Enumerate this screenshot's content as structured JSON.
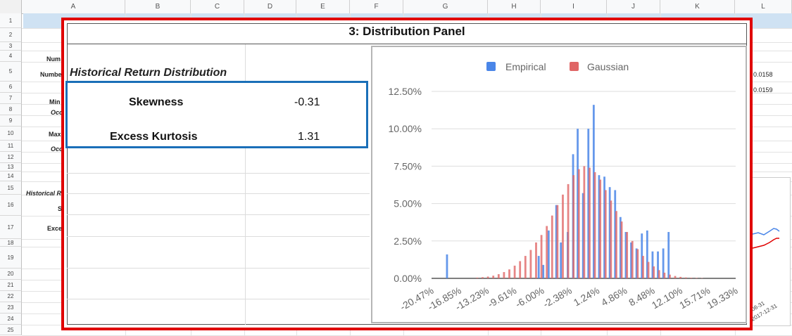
{
  "sheet": {
    "columns": [
      "A",
      "B",
      "C",
      "D",
      "E",
      "F",
      "G",
      "H",
      "I",
      "J",
      "K",
      "L"
    ],
    "rows": [
      "1",
      "2",
      "3",
      "4",
      "5",
      "6",
      "7",
      "8",
      "9",
      "10",
      "11",
      "12",
      "13",
      "14",
      "15",
      "16",
      "17",
      "18",
      "19",
      "20",
      "21",
      "22",
      "23",
      "24",
      "25"
    ],
    "background_cells": {
      "r4": "Num",
      "r5": "Numbe",
      "r7": "Min",
      "r8": "Occ",
      "r10": "Max",
      "r11": "Occ",
      "r15": "Historical R",
      "r16": "S",
      "r17": "Exce",
      "l5": "0.0158",
      "l6": "0.0159",
      "date1": "08-31",
      "date2": "2017-12-31"
    }
  },
  "panel": {
    "title": "3: Distribution Panel",
    "heading": "Historical Return Distribution",
    "stats": [
      {
        "label": "Skewness",
        "value": "-0.31"
      },
      {
        "label": "Excess Kurtosis",
        "value": "1.31"
      }
    ]
  },
  "colors": {
    "highlight_border": "#e00000",
    "stats_border": "#1a6fb8",
    "empirical": "#4a86e8",
    "gaussian": "#e06666",
    "header_band": "#cfe2f3"
  },
  "chart_data": {
    "type": "bar",
    "legend": [
      "Empirical",
      "Gaussian"
    ],
    "legend_position": "top",
    "y_ticks": [
      "0.00%",
      "2.50%",
      "5.00%",
      "7.50%",
      "10.00%",
      "12.50%"
    ],
    "ylim": [
      0,
      12.5
    ],
    "x_ticks": [
      "-20.47%",
      "-16.85%",
      "-13.23%",
      "-9.61%",
      "-6.00%",
      "-2.38%",
      "1.24%",
      "4.86%",
      "8.48%",
      "12.10%",
      "15.71%",
      "19.33%"
    ],
    "xlim": [
      -20.47,
      19.33
    ],
    "series": [
      {
        "name": "Empirical",
        "x": [
          -18.3,
          -6.3,
          -5.7,
          -5.0,
          -4.0,
          -3.4,
          -2.5,
          -1.8,
          -1.2,
          -0.5,
          0.2,
          0.9,
          1.6,
          2.3,
          3.0,
          3.7,
          4.4,
          5.1,
          5.8,
          6.5,
          7.2,
          7.9,
          8.6,
          9.3,
          10.0,
          10.7
        ],
        "values": [
          1.6,
          1.5,
          0.9,
          3.2,
          4.9,
          2.4,
          3.1,
          8.3,
          10.0,
          5.7,
          10.0,
          11.6,
          6.9,
          6.8,
          6.1,
          5.9,
          4.1,
          3.1,
          2.4,
          2.0,
          3.0,
          3.2,
          1.8,
          1.8,
          2.0,
          3.1
        ]
      },
      {
        "name": "Gaussian",
        "x": [
          -14.6,
          -13.9,
          -13.2,
          -12.5,
          -11.8,
          -11.1,
          -10.4,
          -9.7,
          -9.0,
          -8.3,
          -7.6,
          -6.9,
          -6.2,
          -5.5,
          -4.8,
          -4.1,
          -3.4,
          -2.7,
          -2.0,
          -1.3,
          -0.6,
          0.1,
          0.8,
          1.5,
          2.2,
          2.9,
          3.6,
          4.3,
          5.0,
          5.7,
          6.4,
          7.1,
          7.8,
          8.5,
          9.2,
          9.9,
          10.6,
          11.3,
          12.0,
          12.7,
          13.4,
          14.1,
          14.8
        ],
        "values": [
          0.05,
          0.08,
          0.12,
          0.18,
          0.28,
          0.42,
          0.6,
          0.85,
          1.15,
          1.5,
          1.9,
          2.4,
          2.9,
          3.5,
          4.2,
          4.9,
          5.6,
          6.3,
          6.9,
          7.3,
          7.5,
          7.4,
          7.1,
          6.6,
          5.9,
          5.2,
          4.5,
          3.8,
          3.1,
          2.5,
          1.95,
          1.5,
          1.1,
          0.8,
          0.55,
          0.38,
          0.25,
          0.16,
          0.1,
          0.06,
          0.04,
          0.03,
          0.02
        ]
      }
    ]
  }
}
